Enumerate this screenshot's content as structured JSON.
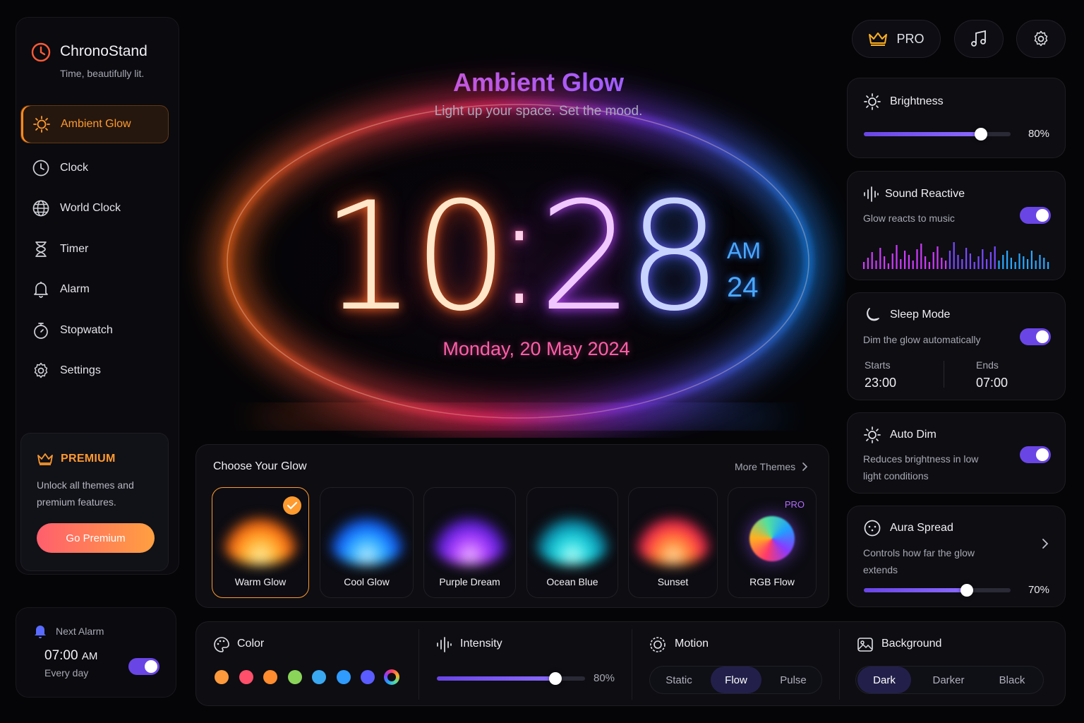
{
  "app": {
    "name": "ChronoStand",
    "tagline": "Time, beautifully lit."
  },
  "sidebar": {
    "items": [
      {
        "label": "Ambient Glow",
        "icon": "sun-icon",
        "active": true
      },
      {
        "label": "Clock",
        "icon": "clock-icon"
      },
      {
        "label": "World Clock",
        "icon": "globe-icon"
      },
      {
        "label": "Timer",
        "icon": "hourglass-icon"
      },
      {
        "label": "Alarm",
        "icon": "bell-icon"
      },
      {
        "label": "Stopwatch",
        "icon": "stopwatch-icon"
      },
      {
        "label": "Settings",
        "icon": "gear-icon"
      }
    ],
    "premium": {
      "title": "PREMIUM",
      "text": "Unlock all themes and premium features.",
      "button": "Go Premium"
    },
    "next_alarm": {
      "label": "Next Alarm",
      "time": "07:00",
      "period": "AM",
      "repeat": "Every day",
      "enabled": true
    }
  },
  "topbar": {
    "pro_label": "PRO"
  },
  "hero": {
    "title": "Ambient Glow",
    "subtitle": "Light up your space. Set the mood.",
    "hours": "10",
    "minutes_1": "2",
    "minutes_2": "8",
    "colon": ":",
    "period": "AM",
    "seconds": "24",
    "date": "Monday, 20 May 2024"
  },
  "themes": {
    "title": "Choose Your Glow",
    "more": "More Themes",
    "items": [
      {
        "label": "Warm Glow",
        "selected": true
      },
      {
        "label": "Cool Glow"
      },
      {
        "label": "Purple Dream"
      },
      {
        "label": "Ocean Blue"
      },
      {
        "label": "Sunset"
      },
      {
        "label": "RGB Flow",
        "badge": "PRO"
      }
    ]
  },
  "panel": {
    "brightness": {
      "title": "Brightness",
      "value": 80,
      "display": "80%"
    },
    "sound": {
      "title": "Sound Reactive",
      "sub": "Glow reacts to music",
      "enabled": true
    },
    "sleep": {
      "title": "Sleep Mode",
      "sub": "Dim the glow automatically",
      "enabled": true,
      "starts_label": "Starts",
      "starts": "23:00",
      "ends_label": "Ends",
      "ends": "07:00"
    },
    "autodim": {
      "title": "Auto Dim",
      "sub": "Reduces brightness in low light conditions",
      "enabled": true
    },
    "aura": {
      "title": "Aura Spread",
      "sub": "Controls how far the glow extends",
      "value": 70,
      "display": "70%"
    }
  },
  "bottom": {
    "color": {
      "title": "Color",
      "swatches": [
        "#ff9a3c",
        "#ff4f6a",
        "#ff8c2e",
        "#8ad45a",
        "#3aa8f0",
        "#2f9bff",
        "#5a5cff"
      ]
    },
    "intensity": {
      "title": "Intensity",
      "value": 80,
      "display": "80%"
    },
    "motion": {
      "title": "Motion",
      "options": [
        "Static",
        "Flow",
        "Pulse"
      ],
      "selected": "Flow"
    },
    "background": {
      "title": "Background",
      "options": [
        "Dark",
        "Darker",
        "Black"
      ],
      "selected": "Dark"
    }
  },
  "colors": {
    "accent": "#6a45e6",
    "warm": "#ff9a2e"
  }
}
